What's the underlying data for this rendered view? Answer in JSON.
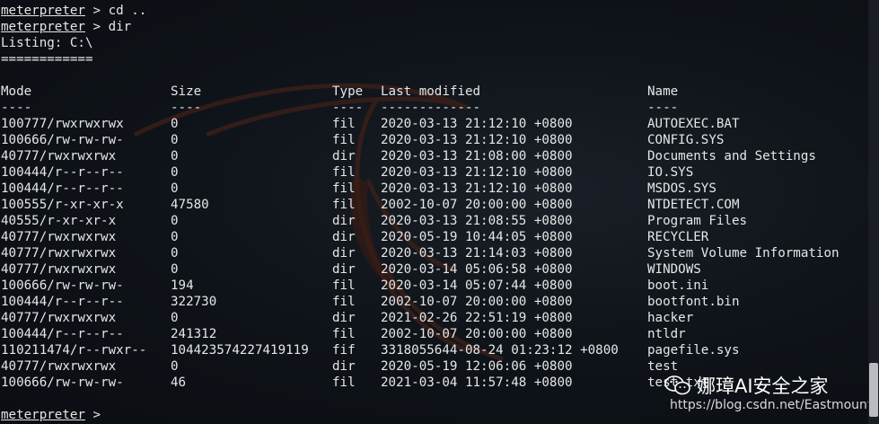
{
  "session": [
    {
      "prompt": "meterpreter",
      "text": " > cd .."
    },
    {
      "prompt": "meterpreter",
      "text": " > dir"
    }
  ],
  "listing_title": "Listing: C:\\",
  "listing_rule": "============",
  "headers": {
    "mode": "Mode",
    "size": "Size",
    "type": "Type",
    "modified": "Last modified",
    "name": "Name"
  },
  "header_rules": {
    "mode": "----",
    "size": "----",
    "type": "----",
    "modified": "-------------",
    "name": "----"
  },
  "rows": [
    {
      "mode": "100777/rwxrwxrwx",
      "size": "0",
      "type": "fil",
      "modified": "2020-03-13 21:12:10 +0800",
      "name": "AUTOEXEC.BAT"
    },
    {
      "mode": "100666/rw-rw-rw-",
      "size": "0",
      "type": "fil",
      "modified": "2020-03-13 21:12:10 +0800",
      "name": "CONFIG.SYS"
    },
    {
      "mode": "40777/rwxrwxrwx",
      "size": "0",
      "type": "dir",
      "modified": "2020-03-13 21:08:00 +0800",
      "name": "Documents and Settings"
    },
    {
      "mode": "100444/r--r--r--",
      "size": "0",
      "type": "fil",
      "modified": "2020-03-13 21:12:10 +0800",
      "name": "IO.SYS"
    },
    {
      "mode": "100444/r--r--r--",
      "size": "0",
      "type": "fil",
      "modified": "2020-03-13 21:12:10 +0800",
      "name": "MSDOS.SYS"
    },
    {
      "mode": "100555/r-xr-xr-x",
      "size": "47580",
      "type": "fil",
      "modified": "2002-10-07 20:00:00 +0800",
      "name": "NTDETECT.COM"
    },
    {
      "mode": "40555/r-xr-xr-x",
      "size": "0",
      "type": "dir",
      "modified": "2020-03-13 21:08:55 +0800",
      "name": "Program Files"
    },
    {
      "mode": "40777/rwxrwxrwx",
      "size": "0",
      "type": "dir",
      "modified": "2020-05-19 10:44:05 +0800",
      "name": "RECYCLER"
    },
    {
      "mode": "40777/rwxrwxrwx",
      "size": "0",
      "type": "dir",
      "modified": "2020-03-13 21:14:03 +0800",
      "name": "System Volume Information"
    },
    {
      "mode": "40777/rwxrwxrwx",
      "size": "0",
      "type": "dir",
      "modified": "2020-03-14 05:06:58 +0800",
      "name": "WINDOWS"
    },
    {
      "mode": "100666/rw-rw-rw-",
      "size": "194",
      "type": "fil",
      "modified": "2020-03-14 05:07:44 +0800",
      "name": "boot.ini"
    },
    {
      "mode": "100444/r--r--r--",
      "size": "322730",
      "type": "fil",
      "modified": "2002-10-07 20:00:00 +0800",
      "name": "bootfont.bin"
    },
    {
      "mode": "40777/rwxrwxrwx",
      "size": "0",
      "type": "dir",
      "modified": "2021-02-26 22:51:19 +0800",
      "name": "hacker"
    },
    {
      "mode": "100444/r--r--r--",
      "size": "241312",
      "type": "fil",
      "modified": "2002-10-07 20:00:00 +0800",
      "name": "ntldr"
    },
    {
      "mode": "110211474/r--rwxr--",
      "size": "104423574227419119",
      "type": "fif",
      "modified": "3318055644-08-24 01:23:12 +0800",
      "name": "pagefile.sys"
    },
    {
      "mode": "40777/rwxrwxrwx",
      "size": "0",
      "type": "dir",
      "modified": "2020-05-19 12:06:06 +0800",
      "name": "test"
    },
    {
      "mode": "100666/rw-rw-rw-",
      "size": "46",
      "type": "fil",
      "modified": "2021-03-04 11:57:48 +0800",
      "name": "test.txt"
    }
  ],
  "final_prompt": {
    "prompt": "meterpreter",
    "text": " > "
  },
  "watermark": {
    "text": "娜璋AI安全之家",
    "url": "https://blog.csdn.net/Eastmount",
    "icon": "wechat-icon"
  },
  "colors": {
    "background": "#0b0f14",
    "text": "#e6e6e6",
    "dragon": "#3a1a14"
  }
}
